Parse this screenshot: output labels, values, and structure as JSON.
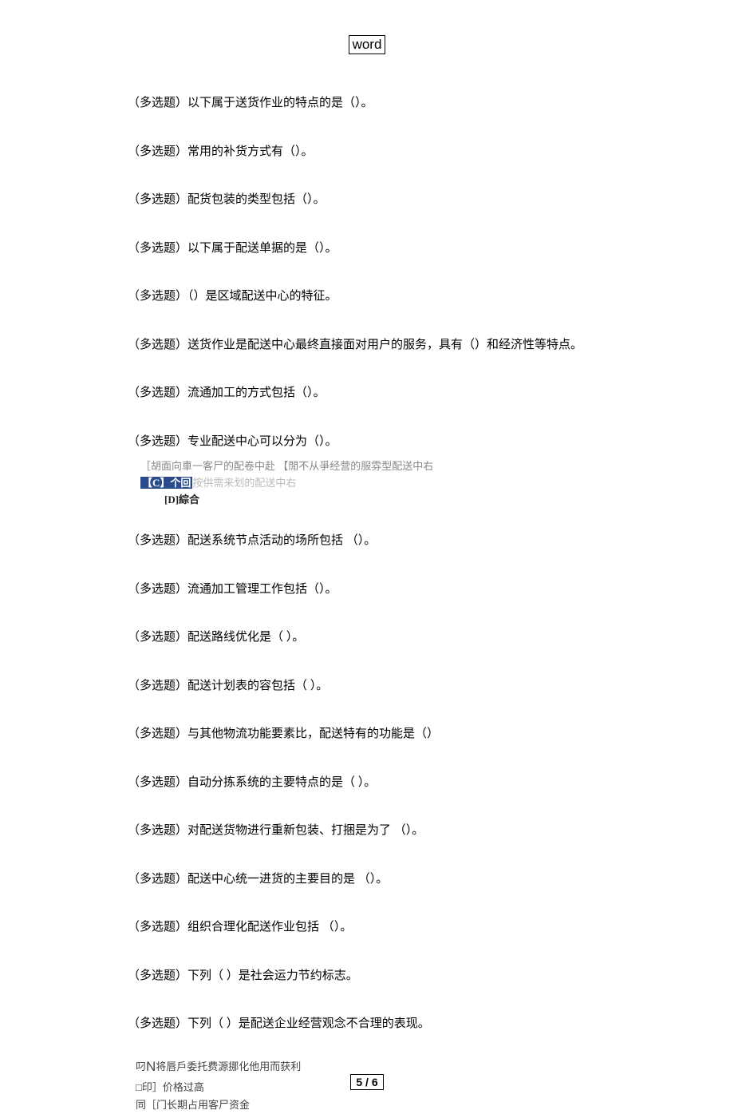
{
  "header": "word",
  "questions": [
    {
      "tag": "（多选题）",
      "text": "以下属于送货作业的特点的是（）。"
    },
    {
      "tag": "（多选题）",
      "text": "常用的补货方式有（）。"
    },
    {
      "tag": "（多选题）",
      "text": "配货包装的类型包括（）。"
    },
    {
      "tag": "（多选题）",
      "text": "以下属于配送单据的是（）。"
    },
    {
      "tag": "（多选题）",
      "text": "（）是区域配送中心的特征。"
    },
    {
      "tag": "（多选题）",
      "text": "送货作业是配送中心最终直接面对用户的服务，具有（）和经济性等特点。"
    },
    {
      "tag": "（多选题）",
      "text": "流通加工的方式包括（）。"
    },
    {
      "tag": "（多选题）",
      "text": "专业配送中心可以分为（）。"
    },
    {
      "tag": "（多选题）",
      "text": "配送系统节点活动的场所包括 （）。"
    },
    {
      "tag": "（多选题）",
      "text": "流通加工管理工作包括（）。"
    },
    {
      "tag": "（多选题）",
      "text": "配送路线优化是（  ）。"
    },
    {
      "tag": "（多选题）",
      "text": "配送计划表的容包括（   ）。"
    },
    {
      "tag": "（多选题）",
      "text": "与其他物流功能要素比，配送特有的功能是（）"
    },
    {
      "tag": "（多选题）",
      "text": "自动分拣系统的主要特点的是（    ）。"
    },
    {
      "tag": "（多选题）",
      "text": "对配送货物进行重新包装、打捆是为了  （）。"
    },
    {
      "tag": "（多选题）",
      "text": "配送中心统一进货的主要目的是 （）。"
    },
    {
      "tag": "（多选题）",
      "text": "组织合理化配送作业包括 （）。"
    },
    {
      "tag": "（多选题）",
      "text": "下列（  ）是社会运力节约标志。"
    },
    {
      "tag": "（多选题）",
      "text": "下列（  ）是配送企业经营观念不合理的表现。"
    }
  ],
  "options_block_1": {
    "line1": "［胡面向車一客尸的配卷中赴 【閒不从爭经营的服雰型配送中右",
    "line2_hl": "【C】个回",
    "line2_rest": "按供需来划的配送中右",
    "line3": "[D]綜合"
  },
  "answers_block": {
    "line1_pre": "叼",
    "line1_big": "N",
    "line1_rest": "将唇戶委托费源挪化他用而获利",
    "line2": "□印］价格过高",
    "line3": "同［门长期占用客尸资金"
  },
  "footer": "5 / 6"
}
